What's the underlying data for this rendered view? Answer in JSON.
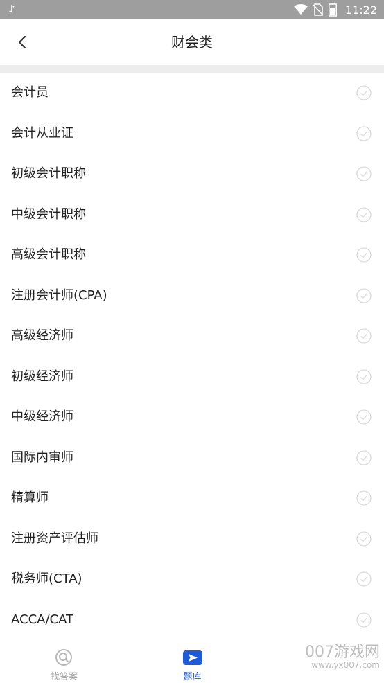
{
  "status_bar": {
    "time": "11:22"
  },
  "header": {
    "title": "财会类"
  },
  "list": {
    "items": [
      {
        "label": "会计员"
      },
      {
        "label": "会计从业证"
      },
      {
        "label": "初级会计职称"
      },
      {
        "label": "中级会计职称"
      },
      {
        "label": "高级会计职称"
      },
      {
        "label": "注册会计师(CPA)"
      },
      {
        "label": "高级经济师"
      },
      {
        "label": "初级经济师"
      },
      {
        "label": "中级经济师"
      },
      {
        "label": "国际内审师"
      },
      {
        "label": "精算师"
      },
      {
        "label": "注册资产评估师"
      },
      {
        "label": "税务师(CTA)"
      },
      {
        "label": "ACCA/CAT"
      }
    ]
  },
  "tabbar": {
    "tabs": [
      {
        "label": "找答案",
        "icon": "search-icon",
        "active": false
      },
      {
        "label": "题库",
        "icon": "send-icon",
        "active": true
      }
    ]
  },
  "watermark": {
    "text": "007游戏网",
    "sub": "www.yx007.com"
  },
  "colors": {
    "accent": "#1e5bd8",
    "inactive": "#a6a6a6",
    "divider": "#ededed",
    "status_bar": "#9e9e9e"
  }
}
